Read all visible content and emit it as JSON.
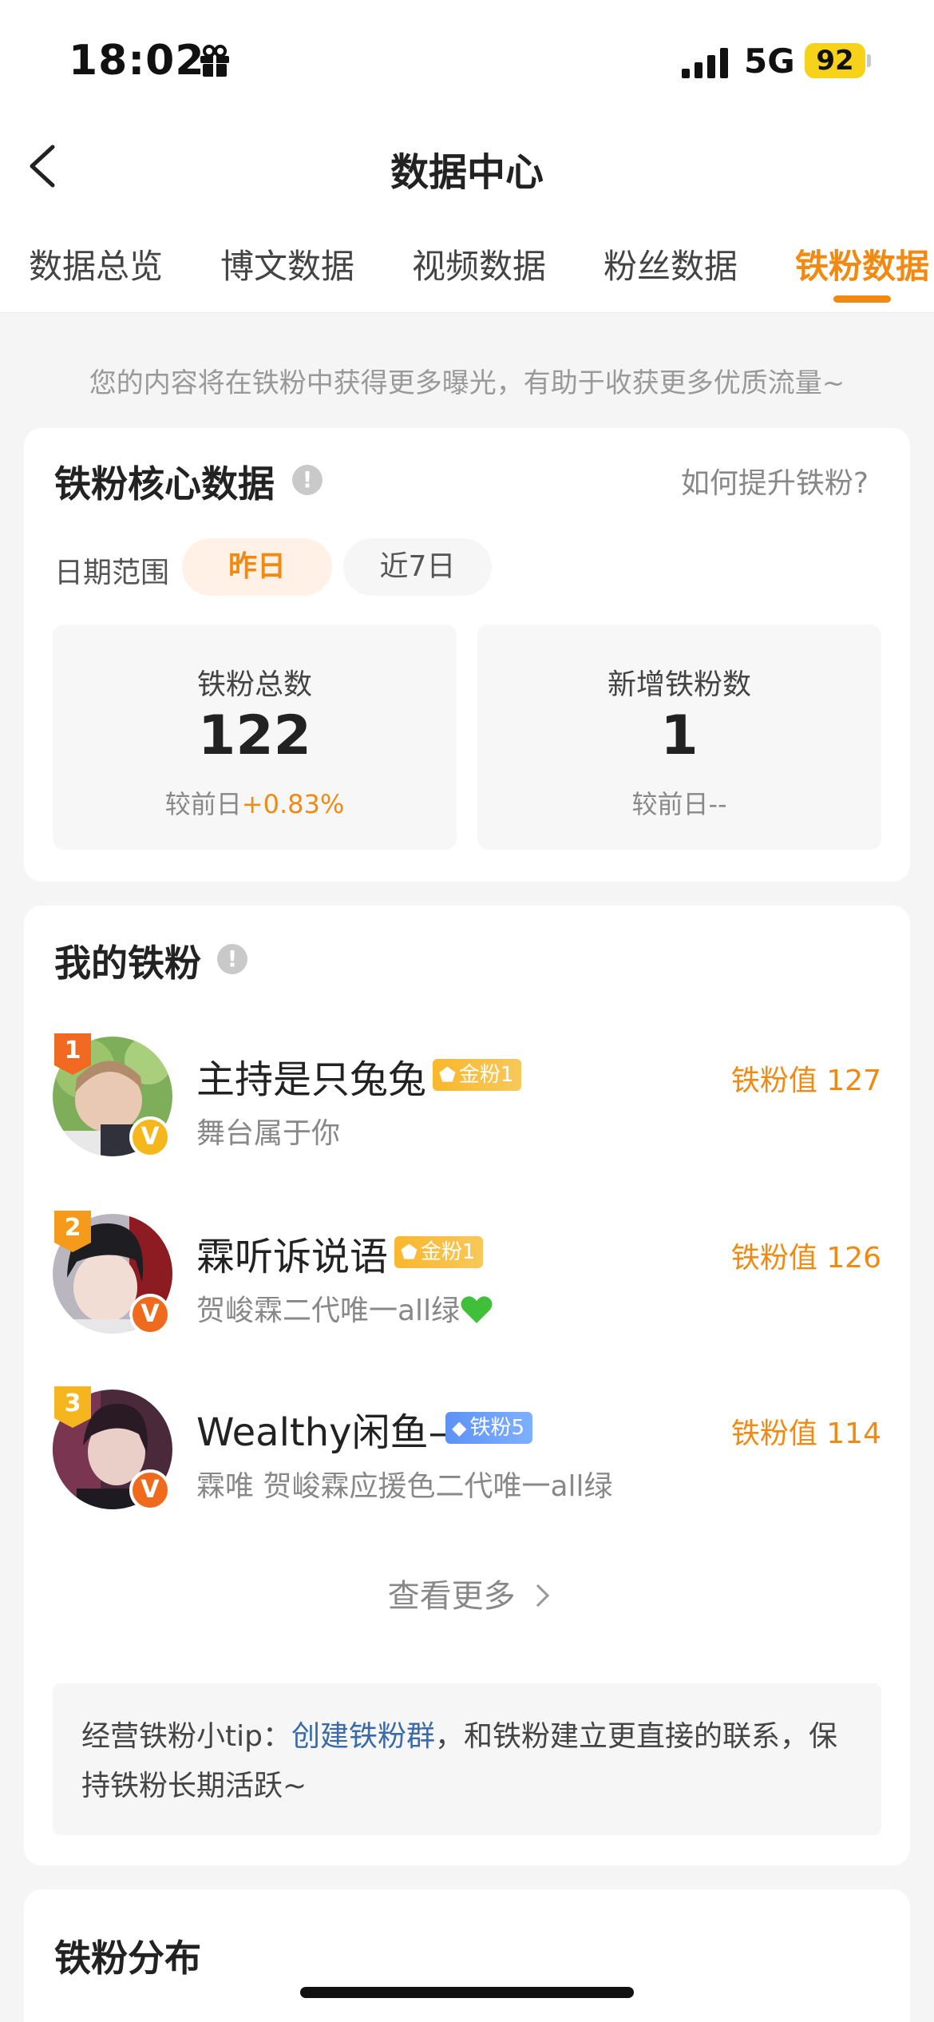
{
  "status_bar": {
    "time": "18:02",
    "network": "5G",
    "battery": "92"
  },
  "nav": {
    "title": "数据中心"
  },
  "tabs": [
    {
      "label": "数据总览",
      "active": false
    },
    {
      "label": "博文数据",
      "active": false
    },
    {
      "label": "视频数据",
      "active": false
    },
    {
      "label": "粉丝数据",
      "active": false
    },
    {
      "label": "铁粉数据",
      "active": true
    }
  ],
  "banner": "您的内容将在铁粉中获得更多曝光，有助于收获更多优质流量~",
  "core": {
    "title": "铁粉核心数据",
    "info": "!",
    "help_link": "如何提升铁粉?",
    "date_label": "日期范围",
    "ranges": [
      "昨日",
      "近7日"
    ],
    "stats": [
      {
        "label": "铁粉总数",
        "value": "122",
        "compare_label": "较前日",
        "change": "+0.83%"
      },
      {
        "label": "新增铁粉数",
        "value": "1",
        "compare_label": "较前日",
        "change": "--"
      }
    ]
  },
  "my_fans": {
    "title": "我的铁粉",
    "info": "!",
    "fans": [
      {
        "rank": "1",
        "name": "主持是只兔兔",
        "level": "金粉1",
        "desc": "舞台属于你",
        "score": "铁粉值 127",
        "verify": "V"
      },
      {
        "rank": "2",
        "name": "霖听诉说语",
        "level": "金粉1",
        "desc": "贺峻霖二代唯一all绿",
        "score": "铁粉值 126",
        "verify": "V"
      },
      {
        "rank": "3",
        "name": "Wealthy闲鱼–",
        "level": "铁粉5",
        "desc": "霖唯 贺峻霖应援色二代唯一all绿",
        "score": "铁粉值 114",
        "verify": "V"
      }
    ],
    "more": "查看更多",
    "tip_prefix": "经营铁粉小tip：",
    "tip_link": "创建铁粉群",
    "tip_suffix": "，和铁粉建立更直接的联系，保持铁粉长期活跃~"
  },
  "distribution": {
    "title": "铁粉分布"
  },
  "colors": {
    "accent": "#f08a12",
    "link": "#3a6aa8",
    "verify_yellow": "#f5b71b",
    "verify_orange": "#f06a1e"
  }
}
